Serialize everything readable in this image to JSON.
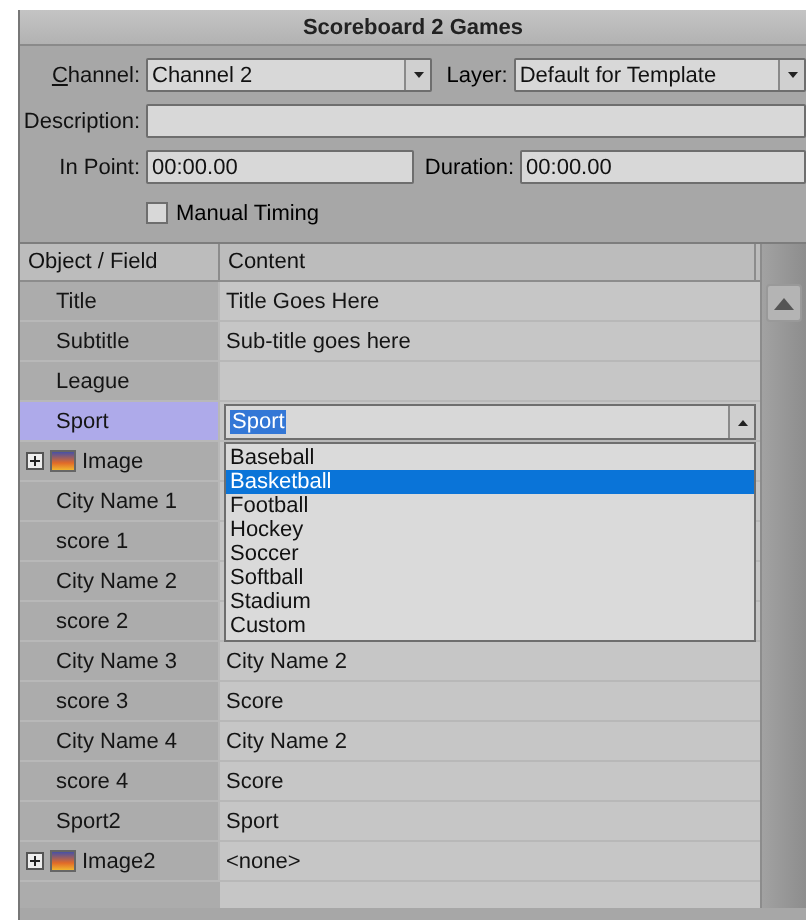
{
  "window": {
    "title": "Scoreboard 2 Games"
  },
  "form": {
    "channel": {
      "label": "Channel:",
      "value": "Channel 2"
    },
    "layer": {
      "label": "Layer:",
      "value": "Default for Template"
    },
    "description": {
      "label": "Description:"
    },
    "in_point": {
      "label": "In Point:",
      "value": "00:00.00"
    },
    "duration": {
      "label": "Duration:",
      "value": "00:00.00"
    },
    "manual_timing": {
      "label": "Manual Timing",
      "checked": false
    }
  },
  "grid": {
    "columns": [
      "Object / Field",
      "Content"
    ],
    "rows": [
      {
        "kind": "text",
        "field": "Title",
        "content": "Title Goes Here",
        "selected": false
      },
      {
        "kind": "text",
        "field": "Subtitle",
        "content": "Sub-title goes here",
        "selected": false
      },
      {
        "kind": "text",
        "field": "League",
        "selected": false
      },
      {
        "kind": "dropdown",
        "field": "Sport",
        "selected": true,
        "editor": {
          "value": "Sport",
          "options": [
            {
              "label": "Baseball",
              "selected": false
            },
            {
              "label": "Basketball",
              "selected": true
            },
            {
              "label": "Football",
              "selected": false
            },
            {
              "label": "Hockey",
              "selected": false
            },
            {
              "label": "Soccer",
              "selected": false
            },
            {
              "label": "Softball",
              "selected": false
            },
            {
              "label": "Stadium",
              "selected": false
            },
            {
              "label": "Custom",
              "selected": false
            }
          ]
        }
      },
      {
        "kind": "image",
        "field": "Image",
        "selected": false
      },
      {
        "kind": "text",
        "field": "City Name 1",
        "selected": false
      },
      {
        "kind": "text",
        "field": "score 1",
        "selected": false
      },
      {
        "kind": "text",
        "field": "City Name 2",
        "selected": false
      },
      {
        "kind": "text",
        "field": "score 2",
        "selected": false
      },
      {
        "kind": "text",
        "field": "City Name 3",
        "content": "City Name 2",
        "selected": false
      },
      {
        "kind": "text",
        "field": "score 3",
        "content": "Score",
        "selected": false
      },
      {
        "kind": "text",
        "field": "City Name 4",
        "content": "City Name 2",
        "selected": false
      },
      {
        "kind": "text",
        "field": "score 4",
        "content": "Score",
        "selected": false
      },
      {
        "kind": "text",
        "field": "Sport2",
        "content": "Sport",
        "selected": false
      },
      {
        "kind": "image",
        "field": "Image2",
        "content": "<none>",
        "selected": false
      }
    ]
  }
}
